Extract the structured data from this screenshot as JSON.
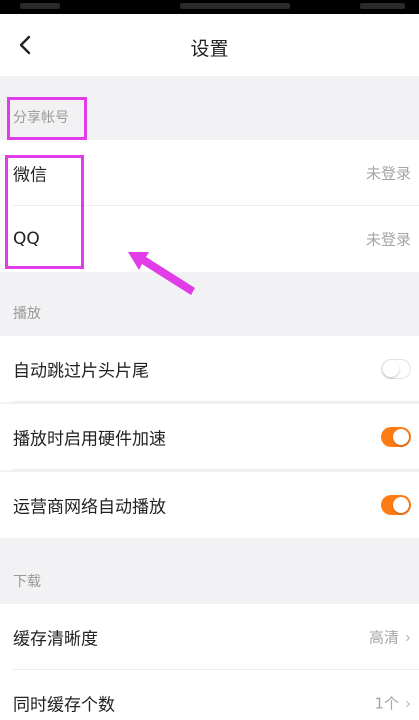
{
  "header": {
    "title": "设置"
  },
  "sections": {
    "share": {
      "title": "分享帐号",
      "items": [
        {
          "label": "微信",
          "value": "未登录"
        },
        {
          "label": "QQ",
          "value": "未登录"
        }
      ]
    },
    "playback": {
      "title": "播放",
      "items": [
        {
          "label": "自动跳过片头片尾",
          "toggle": "off"
        },
        {
          "label": "播放时启用硬件加速",
          "toggle": "on"
        },
        {
          "label": "运营商网络自动播放",
          "toggle": "on"
        }
      ]
    },
    "download": {
      "title": "下载",
      "items": [
        {
          "label": "缓存清晰度",
          "value": "高清"
        },
        {
          "label": "同时缓存个数",
          "value": "1个"
        }
      ]
    }
  },
  "colors": {
    "accent": "#ff7b14",
    "annotation": "#e23be8"
  },
  "icons": {
    "back": "chevron-left-icon",
    "disclosure": "chevron-right-icon"
  }
}
